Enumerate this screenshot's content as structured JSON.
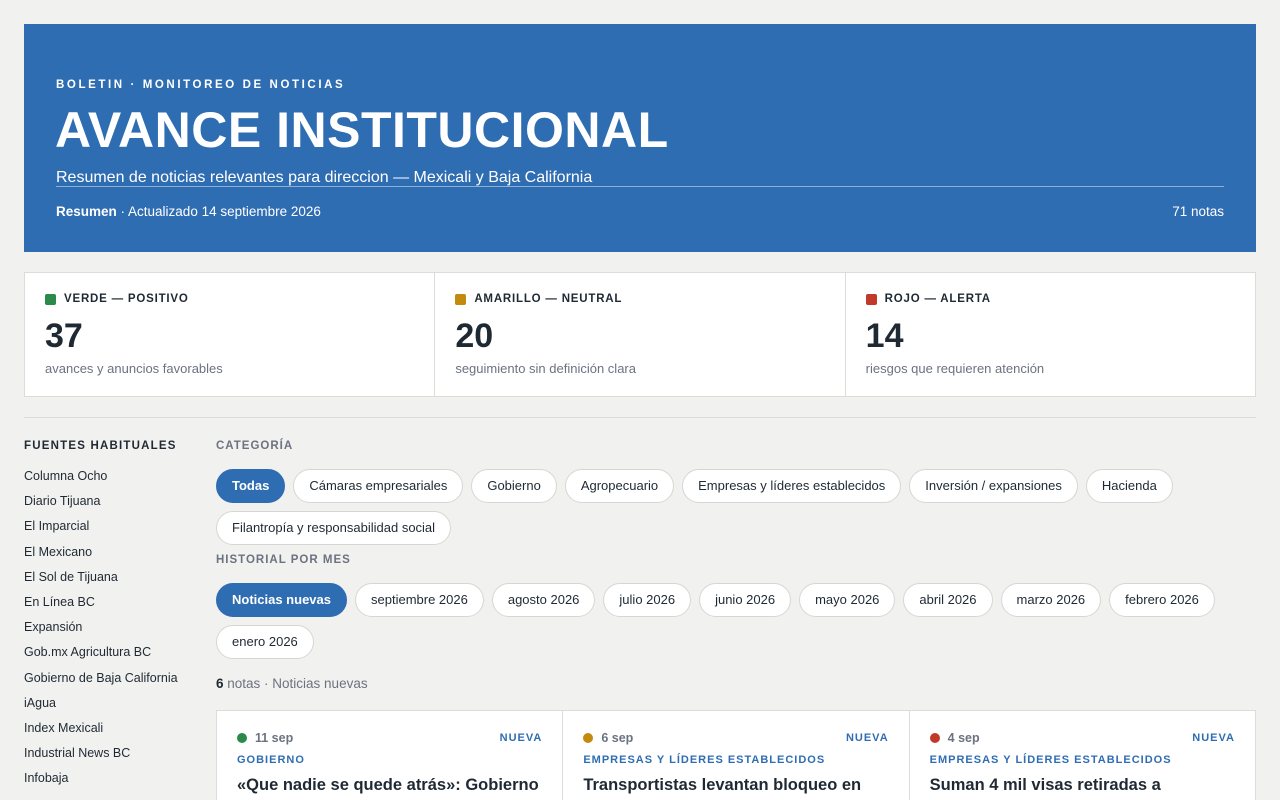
{
  "header": {
    "kicker": "BOLETIN · MONITOREO DE NOTICIAS",
    "title": "AVANCE INSTITUCIONAL",
    "subtitle": "Resumen de noticias relevantes para direccion — Mexicali y Baja California",
    "meta_strong": "Resumen",
    "meta_rest": " · Actualizado 14 septiembre 2026",
    "total": "71 notas"
  },
  "stats": [
    {
      "label": "VERDE — POSITIVO",
      "value": "37",
      "desc": "avances y anuncios favorables",
      "color": "#2a8a4a"
    },
    {
      "label": "AMARILLO — NEUTRAL",
      "value": "20",
      "desc": "seguimiento sin definición clara",
      "color": "#c48a0e"
    },
    {
      "label": "ROJO — ALERTA",
      "value": "14",
      "desc": "riesgos que requieren atención",
      "color": "#c0392b"
    }
  ],
  "sidebar": {
    "title": "FUENTES HABITUALES",
    "items": [
      "Columna Ocho",
      "Diario Tijuana",
      "El Imparcial",
      "El Mexicano",
      "El Sol de Tijuana",
      "En Línea BC",
      "Expansión",
      "Gob.mx Agricultura BC",
      "Gobierno de Baja California",
      "iAgua",
      "Index Mexicali",
      "Industrial News BC",
      "Infobaja"
    ]
  },
  "categories": {
    "label": "CATEGORÍA",
    "items": [
      "Todas",
      "Cámaras empresariales",
      "Gobierno",
      "Agropecuario",
      "Empresas y líderes establecidos",
      "Inversión / expansiones",
      "Hacienda",
      "Filantropía y responsabilidad social"
    ]
  },
  "history": {
    "label": "HISTORIAL POR MES",
    "items": [
      "Noticias nuevas",
      "septiembre 2026",
      "agosto 2026",
      "julio 2026",
      "junio 2026",
      "mayo 2026",
      "abril 2026",
      "marzo 2026",
      "febrero 2026",
      "enero 2026"
    ]
  },
  "results": {
    "count": "6",
    "rest": " notas · Noticias nuevas"
  },
  "cards": [
    {
      "date": "11 sep",
      "badge": "NUEVA",
      "category": "GOBIERNO",
      "title": "«Que nadie se quede atrás»: Gobierno",
      "color": "#2a8a4a"
    },
    {
      "date": "6 sep",
      "badge": "NUEVA",
      "category": "EMPRESAS Y LÍDERES ESTABLECIDOS",
      "title": "Transportistas levantan bloqueo en",
      "color": "#c48a0e"
    },
    {
      "date": "4 sep",
      "badge": "NUEVA",
      "category": "EMPRESAS Y LÍDERES ESTABLECIDOS",
      "title": "Suman 4 mil visas retiradas a",
      "color": "#c0392b"
    }
  ]
}
